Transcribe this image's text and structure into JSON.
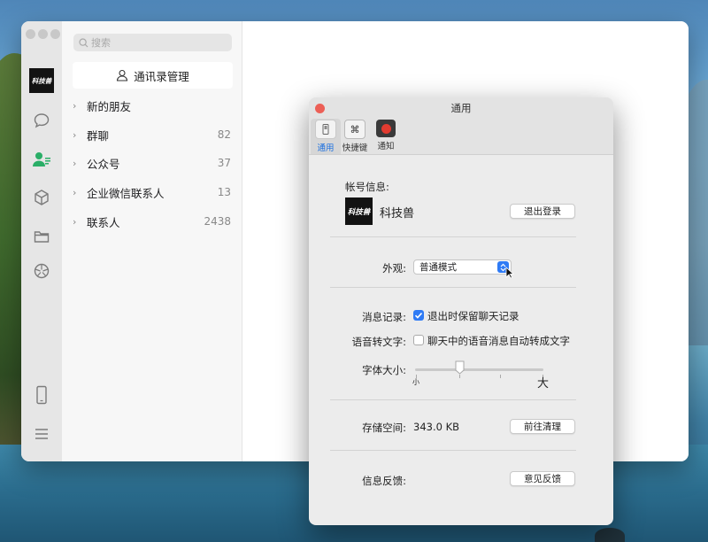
{
  "sidebar_list": {
    "search_placeholder": "搜索",
    "manage_button": "通讯录管理",
    "groups": [
      {
        "label": "新的朋友",
        "count": ""
      },
      {
        "label": "群聊",
        "count": "82"
      },
      {
        "label": "公众号",
        "count": "37"
      },
      {
        "label": "企业微信联系人",
        "count": "13"
      },
      {
        "label": "联系人",
        "count": "2438"
      }
    ]
  },
  "rail": {
    "avatar_text": "科技兽",
    "icons": [
      "chat-icon",
      "contacts-icon",
      "cube-icon",
      "folder-icon",
      "aperture-icon",
      "phone-icon",
      "menu-icon"
    ],
    "active_icon": "contacts-icon",
    "active_color": "#2aae67"
  },
  "settings": {
    "title": "通用",
    "toolbar": [
      {
        "label": "通用",
        "icon": "switch-icon"
      },
      {
        "label": "快捷键",
        "icon": "command-icon"
      },
      {
        "label": "通知",
        "icon": "record-icon"
      }
    ],
    "account": {
      "heading": "帐号信息:",
      "avatar_text": "科技兽",
      "name": "科技兽",
      "logout_button": "退出登录"
    },
    "appearance": {
      "label": "外观:",
      "value": "普通模式"
    },
    "history": {
      "label": "消息记录:",
      "option": "退出时保留聊天记录",
      "checked": true
    },
    "voice_to_text": {
      "label": "语音转文字:",
      "option": "聊天中的语音消息自动转成文字",
      "checked": false
    },
    "font_size": {
      "label": "字体大小:",
      "min_label": "小",
      "max_label": "大",
      "level": 0.35
    },
    "storage": {
      "label": "存储空间:",
      "value": "343.0 KB",
      "button": "前往清理"
    },
    "feedback": {
      "label": "信息反馈:",
      "button": "意见反馈"
    },
    "accent_color": "#2f7bf5"
  }
}
